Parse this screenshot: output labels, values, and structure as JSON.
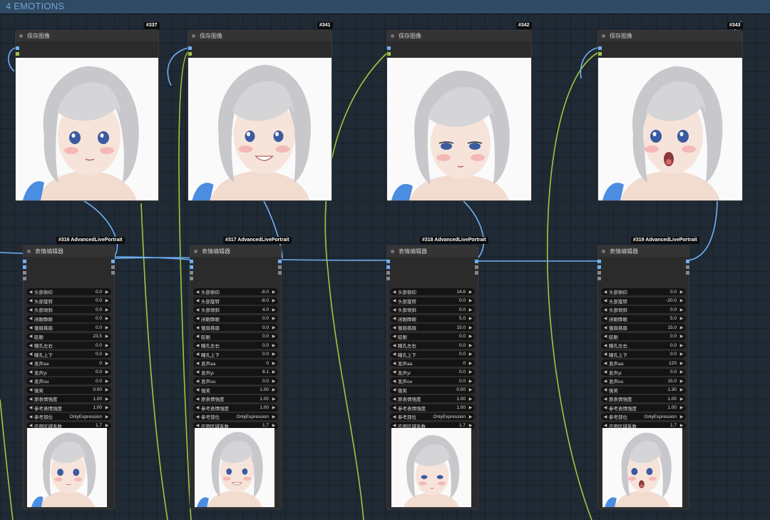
{
  "group": {
    "title": "4 EMOTIONS"
  },
  "save_nodes": [
    {
      "badge": "#337",
      "title": "保存图像"
    },
    {
      "badge": "#341",
      "title": "保存图像"
    },
    {
      "badge": "#342",
      "title": "保存图像"
    },
    {
      "badge": "#343",
      "title": "保存图像"
    }
  ],
  "editor_nodes": [
    {
      "badge": "#316 AdvancedLivePortrait",
      "title": "表情编辑器",
      "params": [
        {
          "label": "头部俯仰",
          "value": "0.0"
        },
        {
          "label": "头部旋转",
          "value": "0.0"
        },
        {
          "label": "头部倾斜",
          "value": "0.0"
        },
        {
          "label": "闭眼睁眼",
          "value": "0.0"
        },
        {
          "label": "皱眉挑眉",
          "value": "0.0"
        },
        {
          "label": "眨眼",
          "value": "23.5"
        },
        {
          "label": "瞳孔左右",
          "value": "0.0"
        },
        {
          "label": "瞳孔上下",
          "value": "0.0"
        },
        {
          "label": "发声aa",
          "value": "0"
        },
        {
          "label": "发声yi",
          "value": "0.0"
        },
        {
          "label": "发声ou",
          "value": "0.0"
        },
        {
          "label": "微笑",
          "value": "0.00"
        },
        {
          "label": "原表情强度",
          "value": "1.00"
        },
        {
          "label": "参考表情强度",
          "value": "1.00"
        },
        {
          "label": "参考部位",
          "value": "OnlyExpression"
        },
        {
          "label": "应用区域系数",
          "value": "1.7"
        }
      ]
    },
    {
      "badge": "#317 AdvancedLivePortrait",
      "title": "表情编辑器",
      "params": [
        {
          "label": "头部俯仰",
          "value": "-8.0"
        },
        {
          "label": "头部旋转",
          "value": "-8.0"
        },
        {
          "label": "头部倾斜",
          "value": "4.0"
        },
        {
          "label": "闭眼睁眼",
          "value": "0.0"
        },
        {
          "label": "皱眉挑眉",
          "value": "0.0"
        },
        {
          "label": "眨眼",
          "value": "0.0"
        },
        {
          "label": "瞳孔左右",
          "value": "0.0"
        },
        {
          "label": "瞳孔上下",
          "value": "0.0"
        },
        {
          "label": "发声aa",
          "value": "0"
        },
        {
          "label": "发声yi",
          "value": "8.1"
        },
        {
          "label": "发声ou",
          "value": "0.0"
        },
        {
          "label": "微笑",
          "value": "1.00"
        },
        {
          "label": "原表情强度",
          "value": "1.00"
        },
        {
          "label": "参考表情强度",
          "value": "1.00"
        },
        {
          "label": "参考部位",
          "value": "OnlyExpression"
        },
        {
          "label": "应用区域系数",
          "value": "1.7"
        }
      ]
    },
    {
      "badge": "#318 AdvancedLivePortrait",
      "title": "表情编辑器",
      "params": [
        {
          "label": "头部俯仰",
          "value": "14.6"
        },
        {
          "label": "头部旋转",
          "value": "0.0"
        },
        {
          "label": "头部倾斜",
          "value": "0.0"
        },
        {
          "label": "闭眼睁眼",
          "value": "5.0"
        },
        {
          "label": "皱眉挑眉",
          "value": "15.0"
        },
        {
          "label": "眨眼",
          "value": "0.0"
        },
        {
          "label": "瞳孔左右",
          "value": "0.0"
        },
        {
          "label": "瞳孔上下",
          "value": "0.0"
        },
        {
          "label": "发声aa",
          "value": "0"
        },
        {
          "label": "发声yi",
          "value": "0.0"
        },
        {
          "label": "发声ou",
          "value": "0.0"
        },
        {
          "label": "微笑",
          "value": "0.00"
        },
        {
          "label": "原表情强度",
          "value": "1.00"
        },
        {
          "label": "参考表情强度",
          "value": "1.00"
        },
        {
          "label": "参考部位",
          "value": "OnlyExpression"
        },
        {
          "label": "应用区域系数",
          "value": "1.7"
        }
      ]
    },
    {
      "badge": "#319 AdvancedLivePortrait",
      "title": "表情编辑器",
      "params": [
        {
          "label": "头部俯仰",
          "value": "0.0"
        },
        {
          "label": "头部旋转",
          "value": "-20.0"
        },
        {
          "label": "头部倾斜",
          "value": "0.0"
        },
        {
          "label": "闭眼睁眼",
          "value": "5.0"
        },
        {
          "label": "皱眉挑眉",
          "value": "15.0"
        },
        {
          "label": "眨眼",
          "value": "0.0"
        },
        {
          "label": "瞳孔左右",
          "value": "0.0"
        },
        {
          "label": "瞳孔上下",
          "value": "0.0"
        },
        {
          "label": "发声aa",
          "value": "120"
        },
        {
          "label": "发声yi",
          "value": "0.0"
        },
        {
          "label": "发声ou",
          "value": "15.0"
        },
        {
          "label": "微笑",
          "value": "1.30"
        },
        {
          "label": "原表情强度",
          "value": "1.00"
        },
        {
          "label": "参考表情强度",
          "value": "1.00"
        },
        {
          "label": "参考部位",
          "value": "OnlyExpression"
        },
        {
          "label": "应用区域系数",
          "value": "1.7"
        }
      ]
    }
  ],
  "colors": {
    "background": "#1f2a35",
    "group_header": "#2f4a63",
    "group_title": "#6fa3d2",
    "image_wire": "#6fb0f2",
    "green_wire": "#a4c639",
    "node_body": "#2b2b2b",
    "node_header": "#343434"
  },
  "icons": {
    "row_decrement": "left-arrow-icon",
    "row_increment": "right-arrow-icon",
    "node_status": "node-dot-icon"
  }
}
